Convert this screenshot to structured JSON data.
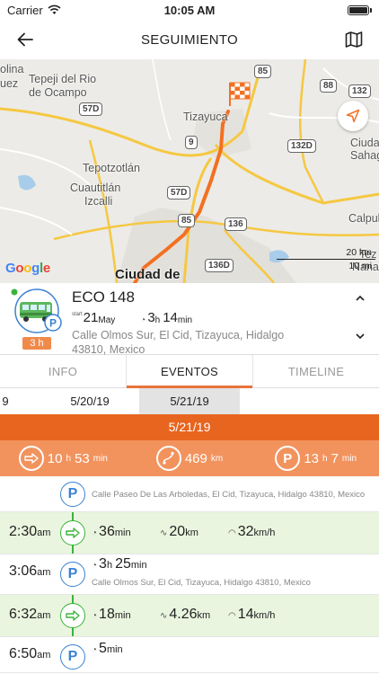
{
  "status_bar": {
    "carrier": "Carrier",
    "time": "10:05 AM"
  },
  "nav": {
    "title": "SEGUIMIENTO",
    "back_icon": "back-arrow-icon",
    "map_icon": "map-icon"
  },
  "map": {
    "labels": {
      "tepeji": "Tepeji del Rio",
      "ocampo": "de Ocampo",
      "olina": "olina",
      "uez": "uez",
      "tizayuca": "Tizayuca",
      "tepotzotlan": "Tepotzotlán",
      "cuautitlan": "Cuautitlán",
      "izcalli": "Izcalli",
      "ciudad": "Ciudad de",
      "ciudad_right": "Ciudad",
      "sahagun": "Sahagu",
      "calpula": "Calpula",
      "tezontepec": "Tez",
      "nanac": "Nanac"
    },
    "shields": {
      "s85": "85",
      "s88": "88",
      "s132": "132",
      "s57d_top": "57D",
      "s9": "9",
      "s132d": "132D",
      "s57d": "57D",
      "s85b": "85",
      "s136": "136",
      "s136d": "136D"
    },
    "google": "Google",
    "scale_km": "20 km",
    "scale_mi": "10 mi"
  },
  "vehicle": {
    "name": "ECO 148",
    "badge": "3 h",
    "start_label": "start",
    "start_day": "21",
    "start_month": "May",
    "duration_h": "3",
    "duration_h_unit": "h",
    "duration_m": "14",
    "duration_m_unit": "min",
    "address": "Calle Olmos Sur, El Cid, Tizayuca, Hidalgo 43810, Mexico"
  },
  "tabs": [
    {
      "label": "INFO"
    },
    {
      "label": "EVENTOS"
    },
    {
      "label": "TIMELINE"
    }
  ],
  "dates": {
    "d1": "9",
    "d2": "5/20/19",
    "d3": "5/21/19"
  },
  "day": {
    "header": "5/21/19",
    "drive_h": "10",
    "drive_h_unit": "h",
    "drive_m": "53",
    "drive_m_unit": "min",
    "distance": "469",
    "distance_unit": "km",
    "park_h": "13",
    "park_h_unit": "h",
    "park_m": "7",
    "park_m_unit": "min"
  },
  "events": [
    {
      "type": "park",
      "address": "Calle Paseo De Las Arboledas, El Cid, Tizayuca, Hidalgo 43810, Mexico"
    },
    {
      "type": "drive",
      "time": "2:30",
      "ampm": "am",
      "duration": "36",
      "duration_unit": "min",
      "distance": "20",
      "distance_unit": "km",
      "speed": "32",
      "speed_unit": "km/h"
    },
    {
      "type": "park",
      "time": "3:06",
      "ampm": "am",
      "duration_h": "3",
      "duration_h_unit": "h",
      "duration_m": "25",
      "duration_m_unit": "min",
      "address": "Calle Olmos Sur, El Cid, Tizayuca, Hidalgo 43810, Mexico"
    },
    {
      "type": "drive",
      "time": "6:32",
      "ampm": "am",
      "duration": "18",
      "duration_unit": "min",
      "distance": "4.26",
      "distance_unit": "km",
      "speed": "14",
      "speed_unit": "km/h"
    },
    {
      "type": "park",
      "time": "6:50",
      "ampm": "am",
      "duration": "5",
      "duration_unit": "min"
    }
  ],
  "colors": {
    "accent": "#e8651f",
    "accent_light": "#f2935e",
    "park_blue": "#3b82d1",
    "drive_green": "#3bb33b",
    "trip_bg": "#e9f5de"
  }
}
